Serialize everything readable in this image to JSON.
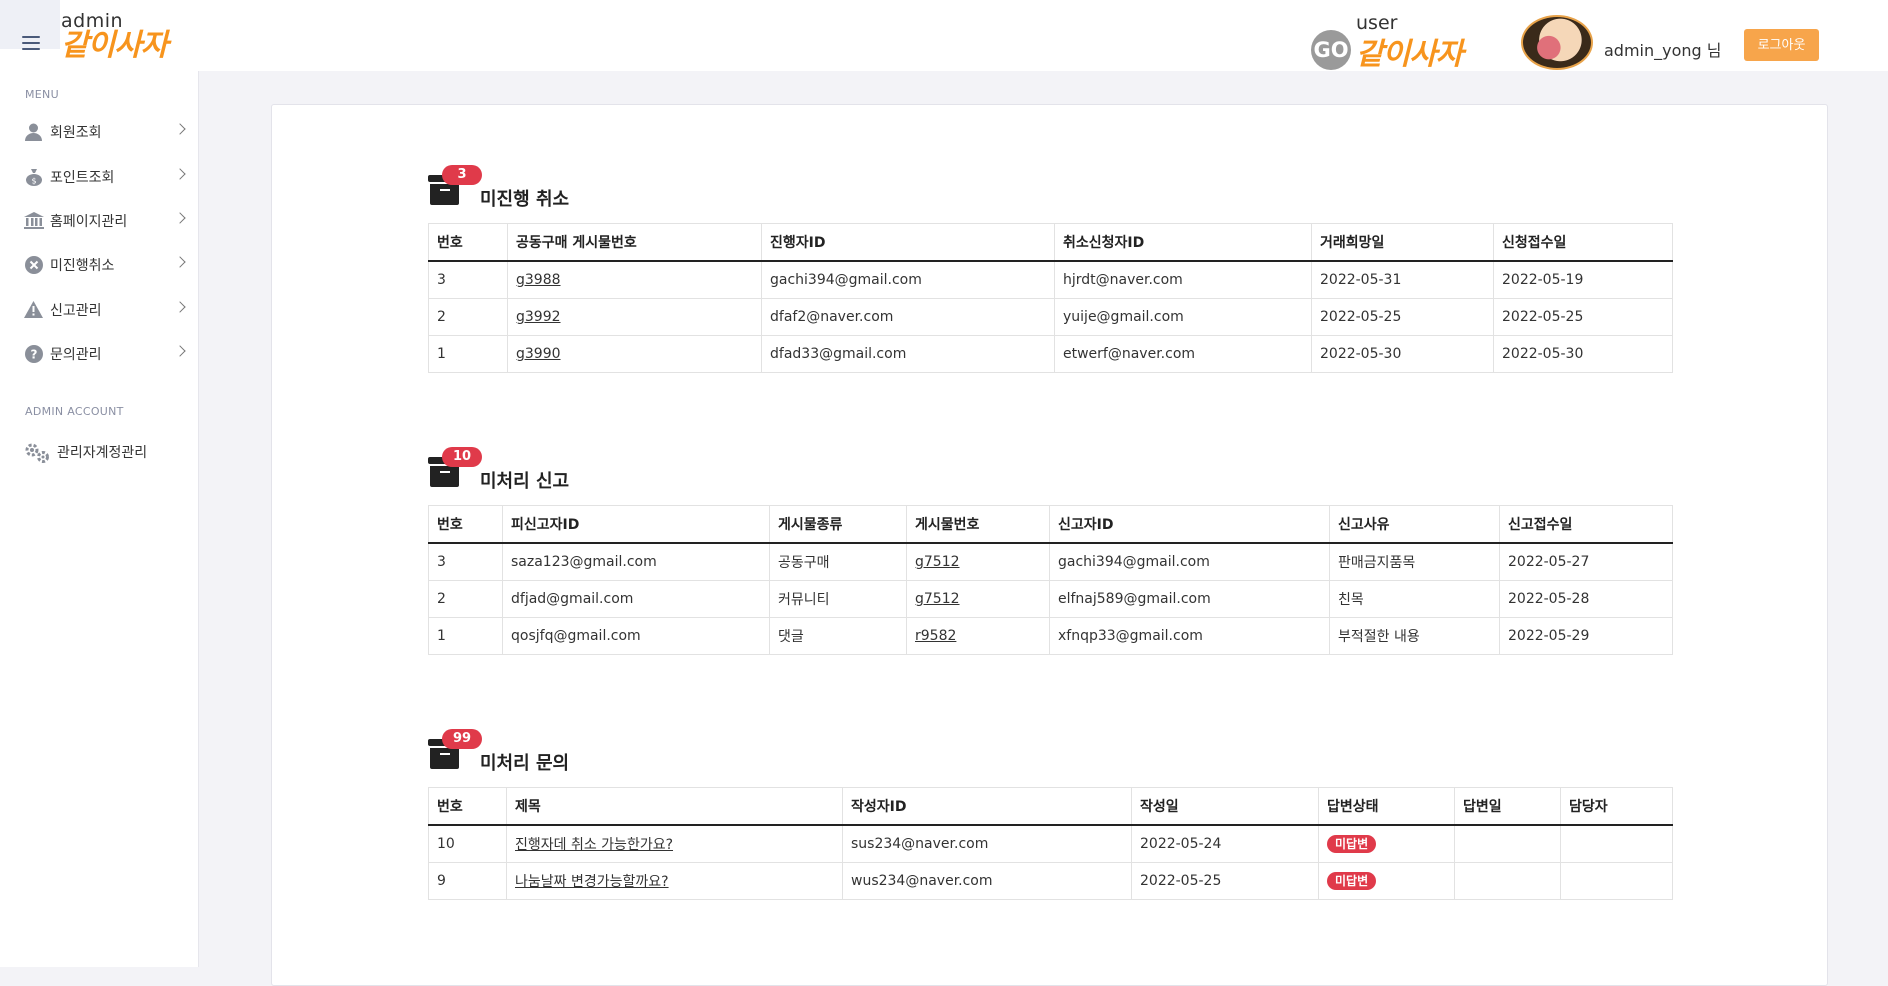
{
  "header": {
    "admin_small": "admin",
    "admin_brand": "같이사자",
    "go_text": "GO",
    "user_small": "user",
    "user_brand": "같이사자",
    "user_name": "admin_yong 님",
    "logout_label": "로그아웃",
    "colors": {
      "brand": "#f7941d",
      "logout": "#f7a54b",
      "badge": "#e03a4a"
    }
  },
  "sidebar": {
    "menu_label": "MENU",
    "items": [
      {
        "label": "회원조회",
        "icon": "user-icon"
      },
      {
        "label": "포인트조회",
        "icon": "money-bag-icon"
      },
      {
        "label": "홈페이지관리",
        "icon": "bank-icon"
      },
      {
        "label": "미진행취소",
        "icon": "cancel-circle-icon"
      },
      {
        "label": "신고관리",
        "icon": "warning-icon"
      },
      {
        "label": "문의관리",
        "icon": "question-icon"
      }
    ],
    "account_label": "ADMIN ACCOUNT",
    "account_items": [
      {
        "label": "관리자계정관리",
        "icon": "gears-icon"
      }
    ]
  },
  "sections": {
    "cancel": {
      "badge": "3",
      "title": "미진행 취소",
      "headers": [
        "번호",
        "공동구매 게시물번호",
        "진행자ID",
        "취소신청자ID",
        "거래희망일",
        "신청접수일"
      ],
      "rows": [
        [
          "3",
          "g3988",
          "gachi394@gmail.com",
          "hjrdt@naver.com",
          "2022-05-31",
          "2022-05-19"
        ],
        [
          "2",
          "g3992",
          "dfaf2@naver.com",
          "yuije@gmail.com",
          "2022-05-25",
          "2022-05-25"
        ],
        [
          "1",
          "g3990",
          "dfad33@gmail.com",
          "etwerf@naver.com",
          "2022-05-30",
          "2022-05-30"
        ]
      ]
    },
    "report": {
      "badge": "10",
      "title": "미처리 신고",
      "headers": [
        "번호",
        "피신고자ID",
        "게시물종류",
        "게시물번호",
        "신고자ID",
        "신고사유",
        "신고접수일"
      ],
      "rows": [
        [
          "3",
          "saza123@gmail.com",
          "공동구매",
          "g7512",
          "gachi394@gmail.com",
          "판매금지품목",
          "2022-05-27"
        ],
        [
          "2",
          "dfjad@gmail.com",
          "커뮤니티",
          "g7512",
          "elfnaj589@gmail.com",
          "친목",
          "2022-05-28"
        ],
        [
          "1",
          "qosjfq@gmail.com",
          "댓글",
          "r9582",
          "xfnqp33@gmail.com",
          "부적절한 내용",
          "2022-05-29"
        ]
      ]
    },
    "inquiry": {
      "badge": "99",
      "title": "미처리 문의",
      "headers": [
        "번호",
        "제목",
        "작성자ID",
        "작성일",
        "답변상태",
        "답변일",
        "담당자"
      ],
      "rows": [
        [
          "10",
          "진행자데 취소 가능한가요?",
          "sus234@naver.com",
          "2022-05-24",
          "미답변",
          "",
          ""
        ],
        [
          "9",
          "나눔날짜 변경가능할까요?",
          "wus234@naver.com",
          "2022-05-25",
          "미답변",
          "",
          ""
        ]
      ]
    }
  }
}
